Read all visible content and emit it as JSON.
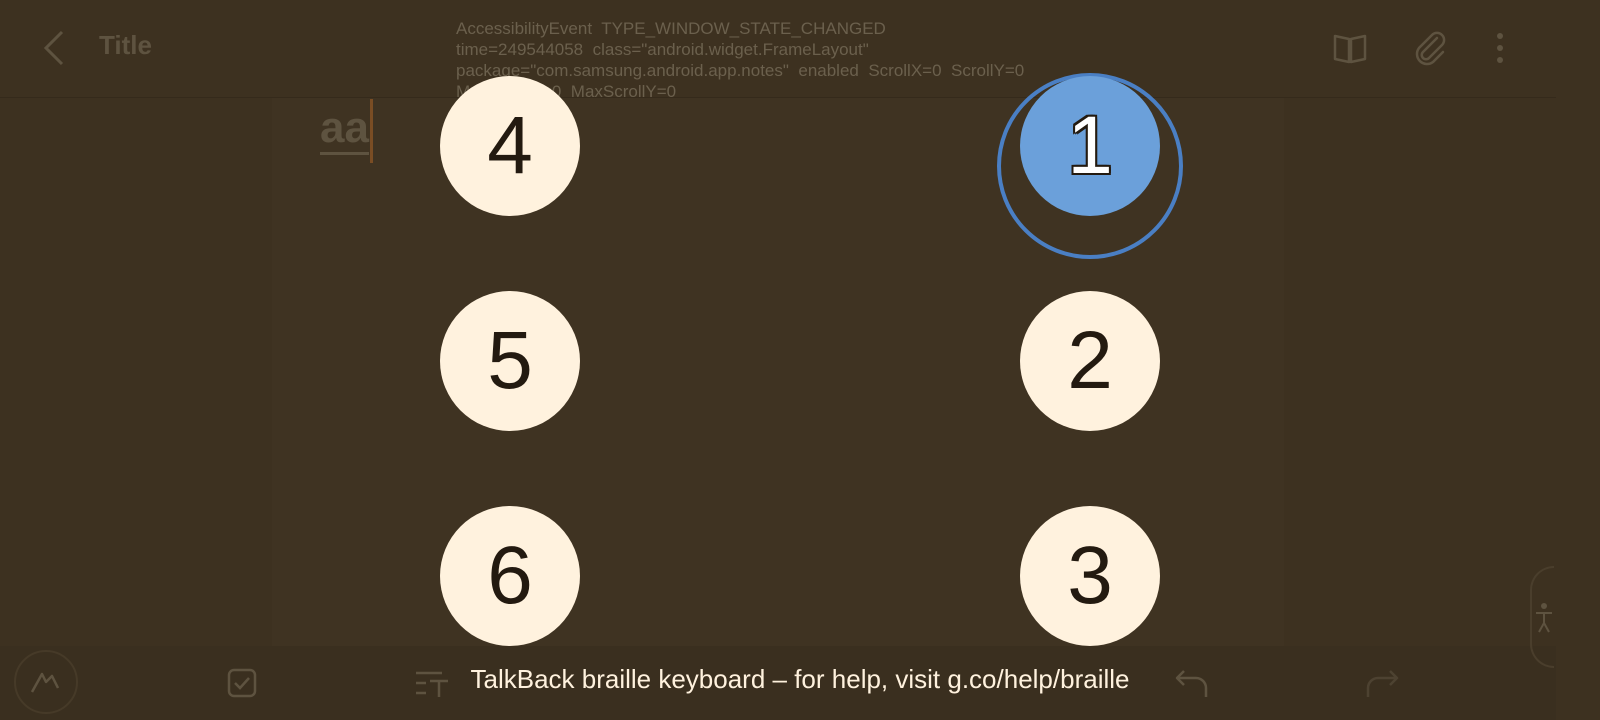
{
  "app": {
    "title": "Title",
    "body_text": "aa"
  },
  "debug_overlay": {
    "lines": [
      "AccessibilityEvent  TYPE_WINDOW_STATE_CHANGED",
      "time=249544058  class=\"android.widget.FrameLayout\"",
      "package=\"com.samsung.android.app.notes\"  enabled  ScrollX=0  ScrollY=0",
      "MaxScrollX=0  MaxScrollY=0"
    ]
  },
  "braille_keyboard": {
    "dots": [
      {
        "label": "1",
        "active": true
      },
      {
        "label": "2",
        "active": false
      },
      {
        "label": "3",
        "active": false
      },
      {
        "label": "4",
        "active": false
      },
      {
        "label": "5",
        "active": false
      },
      {
        "label": "6",
        "active": false
      }
    ],
    "banner": "TalkBack braille keyboard – for help, visit g.co/help/braille"
  },
  "icons": {
    "back": "chevron-left-icon",
    "reading_mode": "book-icon",
    "attach": "paperclip-icon",
    "more": "more-vertical-icon",
    "pen": "pen-icon",
    "checkbox": "checkbox-icon",
    "text": "text-format-icon",
    "undo": "undo-icon",
    "redo": "redo-icon",
    "accessibility": "accessibility-icon"
  },
  "colors": {
    "background": "#3d3120",
    "dot_fill": "#fff2de",
    "dot_active_fill": "#6ba0da",
    "dot_active_ring": "#4a7fc4",
    "dimmed_text": "#5e5340"
  }
}
